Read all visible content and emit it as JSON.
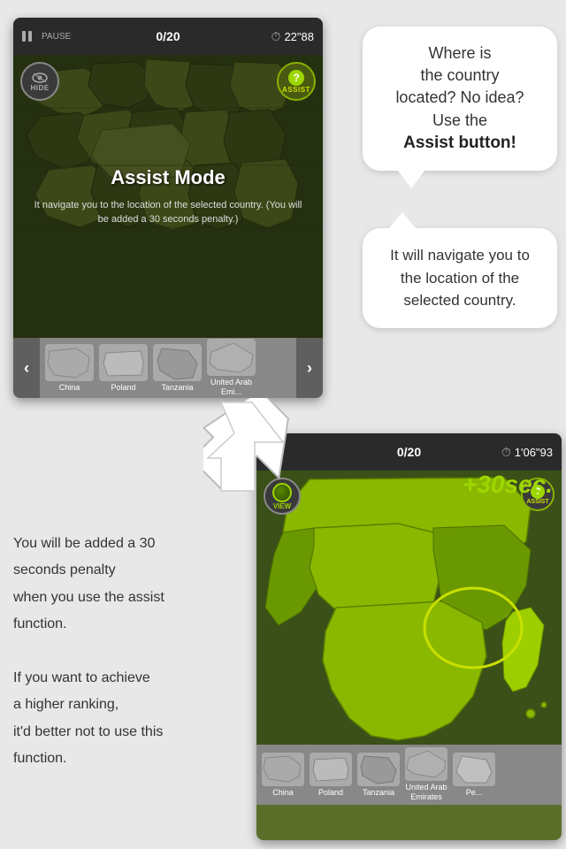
{
  "topScreen": {
    "pauseLabel": "PAUSE",
    "score": "0/20",
    "timer": "22\"88",
    "hideLabel": "HIDE",
    "assistLabel": "ASSIST",
    "assistModeTitle": "Assist Mode",
    "assistModeDesc": "It navigate you to the location of the selected country. (You will be added a 30 seconds penalty.)"
  },
  "bottomScreen": {
    "score": "0/20",
    "timer": "1'06\"93",
    "penaltyText": "+30sec.",
    "viewLabel": "VIEW",
    "assistLabel": "ASSIST"
  },
  "bubble1": {
    "line1": "Where is",
    "line2": "the country",
    "line3": "located? No idea?",
    "line4": "Use the",
    "boldText": "Assist button!"
  },
  "bubble2": {
    "text": "It will navigate you to the location of the selected country."
  },
  "thumbnails": [
    {
      "label": "China",
      "id": "china"
    },
    {
      "label": "Poland",
      "id": "poland"
    },
    {
      "label": "Tanzania",
      "id": "tanzania"
    },
    {
      "label": "United Arab Emirates",
      "id": "uae"
    }
  ],
  "thumbnailsBottom": [
    {
      "label": "China",
      "id": "china"
    },
    {
      "label": "Poland",
      "id": "poland"
    },
    {
      "label": "Tanzania",
      "id": "tanzania"
    },
    {
      "label": "United Arab Emirates",
      "id": "uae"
    },
    {
      "label": "Pe...",
      "id": "peru"
    }
  ],
  "leftText": {
    "line1": "You will be added a 30",
    "line2": "seconds penalty",
    "line3": "when you use the assist",
    "line4": "function.",
    "line5": " If you want to achieve",
    "line6": "a higher ranking,",
    "line7": "it'd better not to use this",
    "line8": "function."
  }
}
